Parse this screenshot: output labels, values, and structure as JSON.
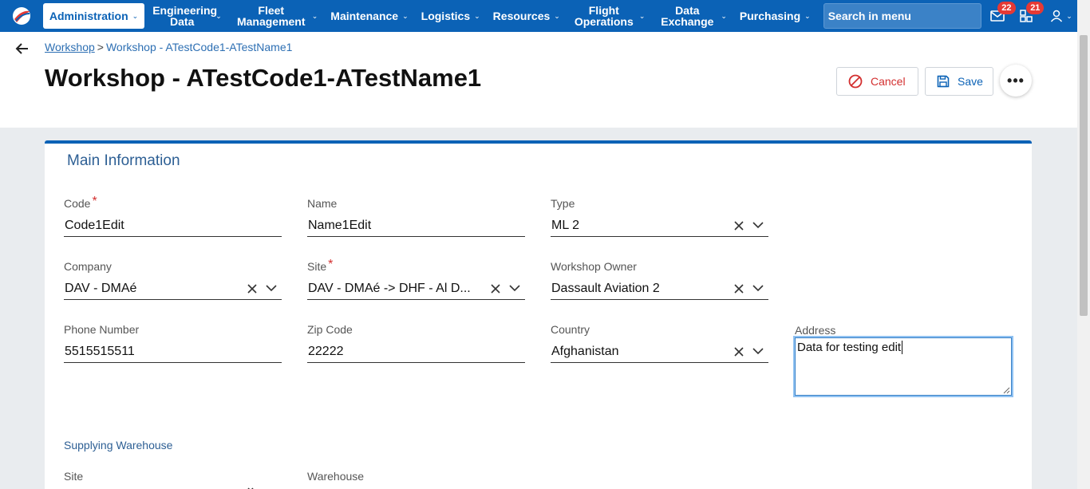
{
  "nav": {
    "items": [
      {
        "label": "Administration",
        "active": true
      },
      {
        "label": "Engineering Data"
      },
      {
        "label": "Fleet Management"
      },
      {
        "label": "Maintenance"
      },
      {
        "label": "Logistics"
      },
      {
        "label": "Resources"
      },
      {
        "label": "Flight Operations"
      },
      {
        "label": "Data Exchange"
      },
      {
        "label": "Purchasing"
      }
    ],
    "search_placeholder": "Search in menu",
    "mail_badge": "22",
    "tasks_badge": "21",
    "icons": [
      "app-logo-icon",
      "mail-icon",
      "tasks-icon",
      "user-icon"
    ]
  },
  "header": {
    "breadcrumb_link": "Workshop",
    "breadcrumb_sep": ">",
    "breadcrumb_current": "Workshop - ATestCode1-ATestName1",
    "title": "Workshop - ATestCode1-ATestName1",
    "cancel_label": "Cancel",
    "save_label": "Save",
    "more_label": "•••"
  },
  "form": {
    "section_title": "Main Information",
    "code": {
      "label": "Code",
      "value": "Code1Edit",
      "required": true
    },
    "name": {
      "label": "Name",
      "value": "Name1Edit"
    },
    "type": {
      "label": "Type",
      "value": "ML 2"
    },
    "company": {
      "label": "Company",
      "value": "DAV - DMAé"
    },
    "site": {
      "label": "Site",
      "value": "DAV - DMAé -> DHF - Al D...",
      "required": true
    },
    "owner": {
      "label": "Workshop Owner",
      "value": "Dassault Aviation 2"
    },
    "phone": {
      "label": "Phone Number",
      "value": "5515515511"
    },
    "zip": {
      "label": "Zip Code",
      "value": "22222"
    },
    "country": {
      "label": "Country",
      "value": "Afghanistan"
    },
    "address": {
      "label": "Address",
      "value": "Data for testing edit"
    },
    "supplying_title": "Supplying Warehouse",
    "sw_site_label": "Site",
    "sw_warehouse_label": "Warehouse"
  },
  "colors": {
    "nav_bg": "#0b62b6",
    "accent": "#0b62b6",
    "danger": "#d32f2f",
    "section": "#2d5f94"
  }
}
